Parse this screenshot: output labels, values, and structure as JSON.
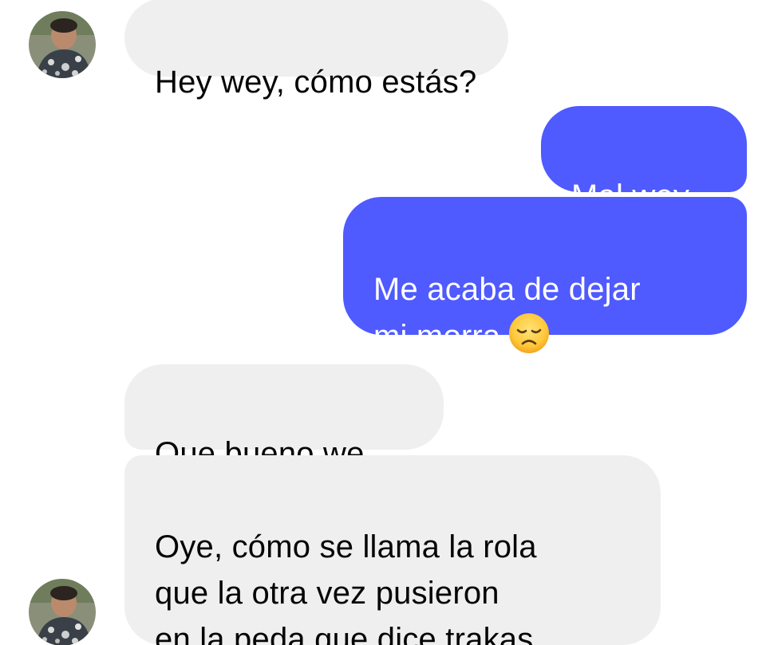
{
  "messages": [
    {
      "sender": "them",
      "text": "Hey wey, cómo estás?"
    },
    {
      "sender": "me",
      "text": "Mal wey"
    },
    {
      "sender": "me",
      "text": "Me acaba de dejar\nmi morra",
      "emoji": "disappointed-face-icon"
    },
    {
      "sender": "them",
      "text": "Que bueno we"
    },
    {
      "sender": "them",
      "text": "Oye, cómo se llama la rola\nque la otra vez pusieron\nen la peda que dice trakas"
    }
  ],
  "colors": {
    "incoming_bubble": "#efeff0",
    "outgoing_bubble": "#4f5aff",
    "incoming_text": "#050505",
    "outgoing_text": "#ffffff"
  }
}
